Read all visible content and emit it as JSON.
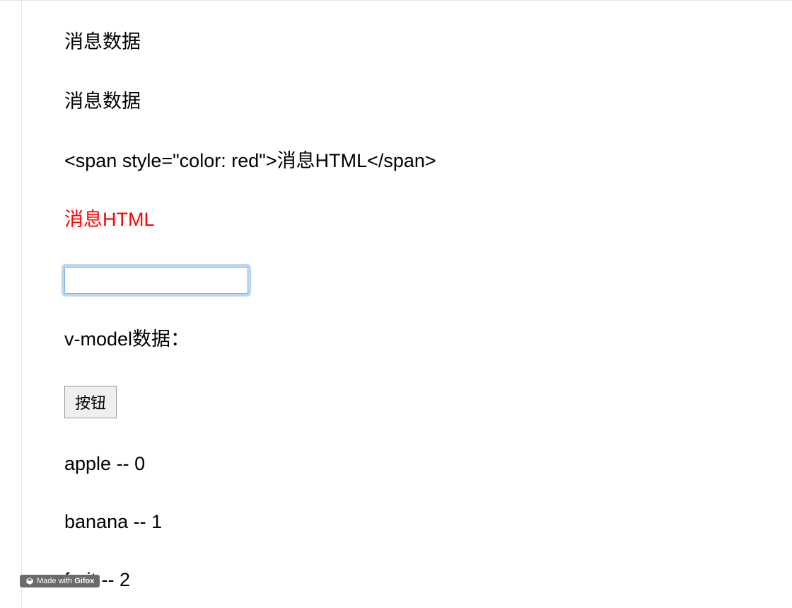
{
  "lines": {
    "msg1": "消息数据",
    "msg2": "消息数据",
    "msg_html_raw": "<span style=\"color: red\">消息HTML</span>",
    "msg_html_rendered": "消息HTML",
    "vmodel_label": "v-model数据：",
    "button_label": "按钮"
  },
  "input": {
    "value": ""
  },
  "list": [
    {
      "name": "apple",
      "sep": " -- ",
      "index": "0"
    },
    {
      "name": "banana",
      "sep": " -- ",
      "index": "1"
    },
    {
      "name": "fruit",
      "sep": " -- ",
      "index": "2"
    }
  ],
  "watermark": {
    "prefix": "Made with ",
    "brand": "Gifox"
  }
}
